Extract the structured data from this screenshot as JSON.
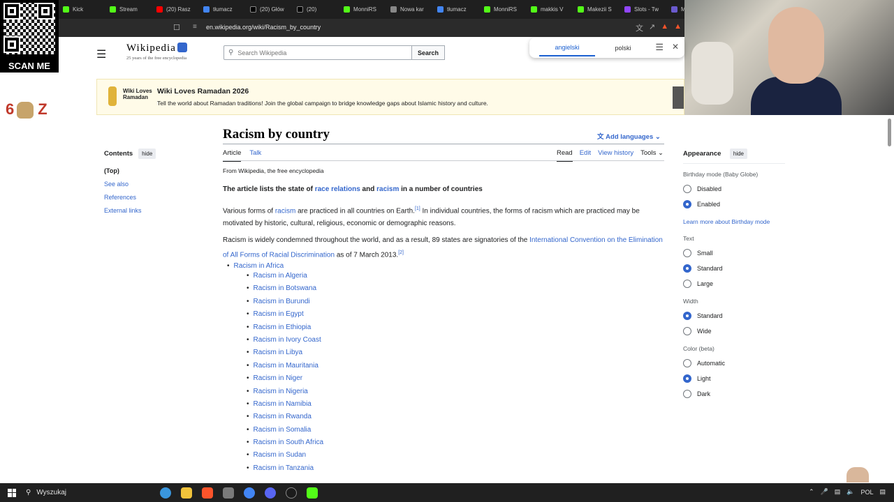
{
  "browser": {
    "tabs": [
      {
        "label": "Kick",
        "color": "#53fc18"
      },
      {
        "label": "Stream",
        "color": "#53fc18"
      },
      {
        "label": "(20) Rasz",
        "color": "#ff0000"
      },
      {
        "label": "tłumacz",
        "color": "#4285f4"
      },
      {
        "label": "(20) Głów",
        "color": "#000000"
      },
      {
        "label": "(20)",
        "color": "#000000"
      },
      {
        "label": "MonniRS",
        "color": "#53fc18"
      },
      {
        "label": "Nowa kar",
        "color": "#888888"
      },
      {
        "label": "tłumacz",
        "color": "#4285f4"
      },
      {
        "label": "MonniRS",
        "color": "#53fc18"
      },
      {
        "label": "makkis V",
        "color": "#53fc18"
      },
      {
        "label": "Makezii S",
        "color": "#53fc18"
      },
      {
        "label": "Slots - Tw",
        "color": "#9146ff"
      },
      {
        "label": "Mos",
        "color": "#6a5acd"
      }
    ],
    "url": "en.wikipedia.org/wiki/Racism_by_country"
  },
  "overlay": {
    "qr_label": "SCAN ME",
    "emote_left": "6",
    "emote_right": "Z"
  },
  "translate": {
    "source": "angielski",
    "target": "polski"
  },
  "header": {
    "logo": "Wikipedia",
    "tagline": "25 years of the free encyclopedia",
    "search_placeholder": "Search Wikipedia",
    "search_button": "Search"
  },
  "banner": {
    "brand": "Wiki Loves Ramadan",
    "title": "Wiki Loves Ramadan 2026",
    "description": "Tell the world about Ramadan traditions! Join the global campaign to bridge knowledge gaps about Islamic history and culture."
  },
  "toc": {
    "title": "Contents",
    "hide": "hide",
    "items": [
      "(Top)",
      "See also",
      "References",
      "External links"
    ]
  },
  "article": {
    "title": "Racism by country",
    "add_languages": "Add languages",
    "tab_article": "Article",
    "tab_talk": "Talk",
    "tab_read": "Read",
    "tab_edit": "Edit",
    "tab_history": "View history",
    "tab_tools": "Tools",
    "from": "From Wikipedia, the free encyclopedia",
    "lede_1": "The article lists the state of ",
    "lede_link1": "race relations",
    "lede_2": " and ",
    "lede_link2": "racism",
    "lede_3": " in a number of countries",
    "p1_1": "Various forms of ",
    "p1_link": "racism",
    "p1_2": " are practiced in all countries on Earth.",
    "p1_ref": "[1]",
    "p1_3": " In individual countries, the forms of racism which are practiced may be motivated by historic, cultural, religious, economic or demographic reasons.",
    "p2_1": "Racism is widely condemned throughout the world, and as a result, 89 states are signatories of the ",
    "p2_link": "International Convention on the Elimination of All Forms of Racial Discrimination",
    "p2_2": " as of 7 March 2013.",
    "p2_ref": "[2]",
    "africa": "Racism in Africa",
    "countries": [
      "Racism in Algeria",
      "Racism in Botswana",
      "Racism in Burundi",
      "Racism in Egypt",
      "Racism in Ethiopia",
      "Racism in Ivory Coast",
      "Racism in Libya",
      "Racism in Mauritania",
      "Racism in Niger",
      "Racism in Nigeria",
      "Racism in Namibia",
      "Racism in Rwanda",
      "Racism in Somalia",
      "Racism in South Africa",
      "Racism in Sudan",
      "Racism in Tanzania"
    ]
  },
  "appearance": {
    "title": "Appearance",
    "hide": "hide",
    "birthday_title": "Birthday mode (Baby Globe)",
    "birthday_disabled": "Disabled",
    "birthday_enabled": "Enabled",
    "learn_more": "Learn more about Birthday mode",
    "text_title": "Text",
    "text_small": "Small",
    "text_standard": "Standard",
    "text_large": "Large",
    "width_title": "Width",
    "width_standard": "Standard",
    "width_wide": "Wide",
    "color_title": "Color (beta)",
    "color_automatic": "Automatic",
    "color_light": "Light",
    "color_dark": "Dark"
  },
  "taskbar": {
    "search": "Wyszukaj",
    "lang": "POL",
    "apps": [
      "#3a96dd",
      "#f0c23b",
      "#fb542b",
      "#7a7a7a",
      "#4285f4",
      "#5865f2",
      "#1c1c1c",
      "#53fc18"
    ]
  }
}
